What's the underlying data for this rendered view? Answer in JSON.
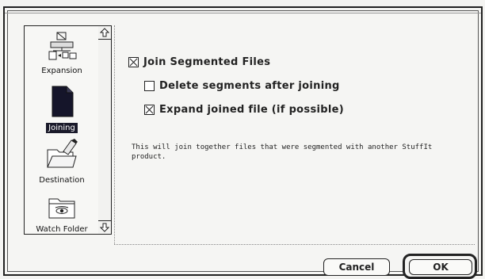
{
  "sidebar": {
    "items": [
      {
        "label": "Expansion",
        "icon": "expansion-icon",
        "selected": false
      },
      {
        "label": "Joining",
        "icon": "document-icon",
        "selected": true
      },
      {
        "label": "Destination",
        "icon": "destination-icon",
        "selected": false
      },
      {
        "label": "Watch Folder",
        "icon": "watch-folder-icon",
        "selected": false
      }
    ]
  },
  "options": {
    "join_segmented": {
      "label": "Join Segmented Files",
      "checked": true
    },
    "delete_segments": {
      "label": "Delete segments after joining",
      "checked": false
    },
    "expand_joined": {
      "label": "Expand joined file (if possible)",
      "checked": true
    }
  },
  "description": "This will join together files that were segmented with another StuffIt product.",
  "buttons": {
    "cancel": "Cancel",
    "ok": "OK"
  }
}
